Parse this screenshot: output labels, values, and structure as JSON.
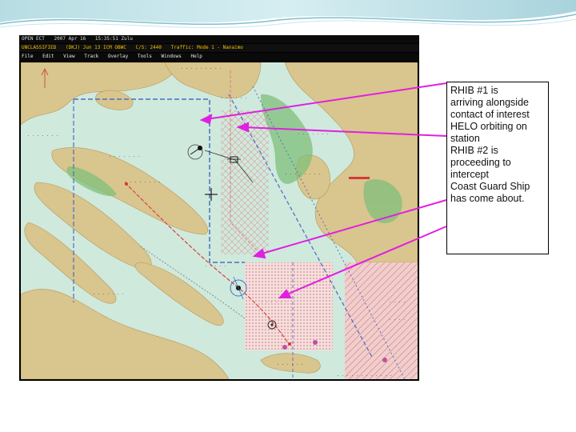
{
  "map": {
    "title_bar": [
      "OPEN ECT",
      "2007 Apr 16",
      "15:35:51 Zulu"
    ],
    "status_bar": [
      "UNCLASSIFIED",
      "(DKJ) Jun 13 ICM OBWC",
      "C/S: 2440",
      "Traffic: Mode 1 - Nanaimo"
    ],
    "menu_bar": [
      "File",
      "Edit",
      "View",
      "Track",
      "Overlay",
      "Tools",
      "Windows",
      "Help"
    ],
    "brand_color": "#f2c200"
  },
  "callout": {
    "lines": [
      "RHIB #1 is",
      "arriving alongside",
      "contact of interest",
      "HELO orbiting on",
      "station",
      "RHIB #2 is",
      "proceeding to",
      "intercept",
      "Coast Guard Ship",
      "has come about."
    ],
    "arrow_color": "#e020e0"
  }
}
